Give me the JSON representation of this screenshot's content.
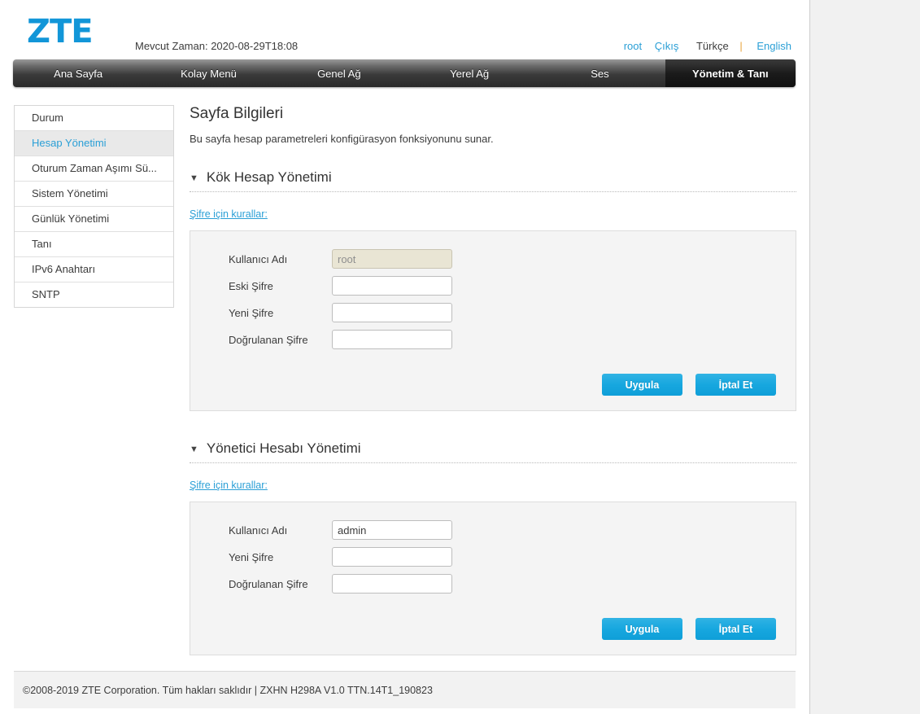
{
  "header": {
    "logo": "ZTE",
    "current_time_label": "Mevcut Zaman: 2020-08-29T18:08",
    "user": "root",
    "logout": "Çıkış",
    "lang_current": "Türkçe",
    "lang_separator": "|",
    "lang_other": "English"
  },
  "nav": {
    "items": [
      {
        "label": "Ana Sayfa",
        "active": false
      },
      {
        "label": "Kolay Menü",
        "active": false
      },
      {
        "label": "Genel Ağ",
        "active": false
      },
      {
        "label": "Yerel Ağ",
        "active": false
      },
      {
        "label": "Ses",
        "active": false
      },
      {
        "label": "Yönetim & Tanı",
        "active": true
      }
    ]
  },
  "sidebar": {
    "items": [
      {
        "label": "Durum",
        "active": false
      },
      {
        "label": "Hesap Yönetimi",
        "active": true
      },
      {
        "label": "Oturum Zaman Aşımı Sü...",
        "active": false
      },
      {
        "label": "Sistem Yönetimi",
        "active": false
      },
      {
        "label": "Günlük Yönetimi",
        "active": false
      },
      {
        "label": "Tanı",
        "active": false
      },
      {
        "label": "IPv6 Anahtarı",
        "active": false
      },
      {
        "label": "SNTP",
        "active": false
      }
    ]
  },
  "main": {
    "title": "Sayfa Bilgileri",
    "description": "Bu sayfa hesap parametreleri konfigürasyon fonksiyonunu sunar.",
    "triangle_glyph": "▼",
    "sections": [
      {
        "heading": "Kök Hesap Yönetimi",
        "rules_link": "Şifre için kurallar:",
        "fields": [
          {
            "label": "Kullanıcı Adı",
            "value": "root",
            "placeholder": "",
            "readonly": true,
            "type": "text"
          },
          {
            "label": "Eski Şifre",
            "value": "",
            "placeholder": "",
            "readonly": false,
            "type": "password"
          },
          {
            "label": "Yeni Şifre",
            "value": "",
            "placeholder": "",
            "readonly": false,
            "type": "password"
          },
          {
            "label": "Doğrulanan Şifre",
            "value": "",
            "placeholder": "",
            "readonly": false,
            "type": "password"
          }
        ],
        "apply_label": "Uygula",
        "cancel_label": "İptal  Et"
      },
      {
        "heading": "Yönetici Hesabı Yönetimi",
        "rules_link": "Şifre için kurallar:",
        "fields": [
          {
            "label": "Kullanıcı Adı",
            "value": "admin",
            "placeholder": "",
            "readonly": false,
            "type": "text"
          },
          {
            "label": "Yeni Şifre",
            "value": "",
            "placeholder": "",
            "readonly": false,
            "type": "password"
          },
          {
            "label": "Doğrulanan Şifre",
            "value": "",
            "placeholder": "",
            "readonly": false,
            "type": "password"
          }
        ],
        "apply_label": "Uygula",
        "cancel_label": "İptal  Et"
      }
    ]
  },
  "footer": {
    "text": "©2008-2019 ZTE Corporation. Tüm hakları saklıdır  |   ZXHN H298A V1.0 TTN.14T1_190823"
  },
  "colors": {
    "brand_blue": "#1296d8",
    "link_blue": "#2a9fd6",
    "button_blue": "#17a7df",
    "nav_dark": "#2a2a2a",
    "readonly_field": "#e9e5d4"
  }
}
